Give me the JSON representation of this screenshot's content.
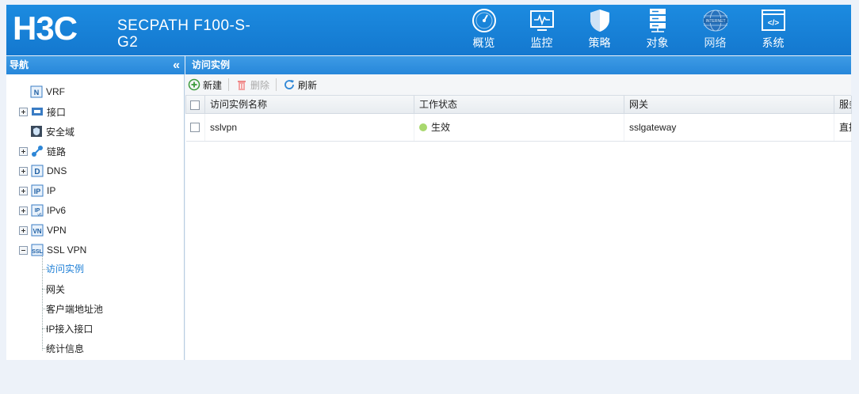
{
  "header": {
    "logo_text": "H3C",
    "product": "SECPATH F100-S-G2",
    "product_line1": "SECPATH F100-S-",
    "product_line2": "G2",
    "nav": [
      {
        "label": "概览",
        "icon": "gauge-icon"
      },
      {
        "label": "监控",
        "icon": "monitor-icon"
      },
      {
        "label": "策略",
        "icon": "shield-icon"
      },
      {
        "label": "对象",
        "icon": "server-icon"
      },
      {
        "label": "网络",
        "icon": "internet-globe-icon",
        "icon_text": "INTERNET"
      },
      {
        "label": "系统",
        "icon": "code-window-icon",
        "icon_text": "</>"
      }
    ]
  },
  "sidebar": {
    "title": "导航",
    "collapse_glyph": "«",
    "items": [
      {
        "label": "VRF",
        "icon": "vrf-icon",
        "expander": "none"
      },
      {
        "label": "接口",
        "icon": "interface-icon",
        "expander": "plus"
      },
      {
        "label": "安全域",
        "icon": "security-zone-icon",
        "expander": "none"
      },
      {
        "label": "链路",
        "icon": "link-icon",
        "expander": "plus"
      },
      {
        "label": "DNS",
        "icon": "dns-icon",
        "expander": "plus"
      },
      {
        "label": "IP",
        "icon": "ip-icon",
        "expander": "plus"
      },
      {
        "label": "IPv6",
        "icon": "ipv6-icon",
        "expander": "plus"
      },
      {
        "label": "VPN",
        "icon": "vpn-icon",
        "expander": "plus"
      },
      {
        "label": "SSL VPN",
        "icon": "ssl-vpn-icon",
        "expander": "minus"
      }
    ],
    "subitems": [
      {
        "label": "访问实例",
        "active": true
      },
      {
        "label": "网关",
        "active": false
      },
      {
        "label": "客户端地址池",
        "active": false
      },
      {
        "label": "IP接入接口",
        "active": false
      },
      {
        "label": "统计信息",
        "active": false
      }
    ]
  },
  "main": {
    "title": "访问实例",
    "toolbar": {
      "new_label": "新建",
      "delete_label": "删除",
      "refresh_label": "刷新"
    },
    "table": {
      "columns": [
        "访问实例名称",
        "工作状态",
        "网关",
        "服务"
      ],
      "columns_visible": [
        "访问实例名称",
        "工作状态",
        "网关",
        "服务"
      ],
      "rows": [
        {
          "name": "sslvpn",
          "status": "生效",
          "status_color": "#a8d86e",
          "gateway": "sslgateway",
          "service": "直接"
        }
      ]
    }
  },
  "colors": {
    "header_blue": "#1680d6",
    "active_link": "#1e7fd6",
    "status_active": "#a8d86e"
  }
}
